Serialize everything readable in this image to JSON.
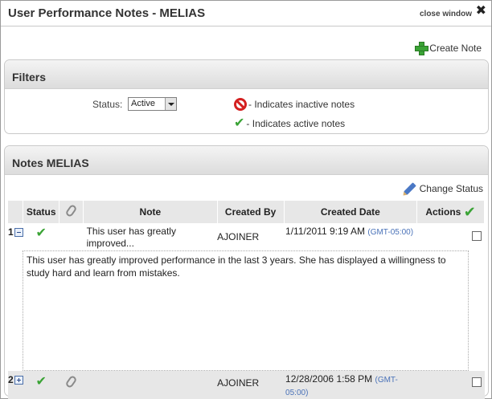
{
  "window": {
    "title": "User Performance Notes - MELIAS",
    "close_label": "close window",
    "close_glyph": "✖"
  },
  "toolbar": {
    "create_note_label": "Create Note"
  },
  "filters": {
    "heading": "Filters",
    "status_label": "Status:",
    "status_value": "Active",
    "legend_inactive": "- Indicates inactive notes",
    "legend_active": "- Indicates active notes"
  },
  "notes": {
    "heading": "Notes MELIAS",
    "change_status_label": "Change Status",
    "columns": {
      "status": "Status",
      "note": "Note",
      "created_by": "Created By",
      "created_date": "Created Date",
      "actions": "Actions"
    },
    "rows": [
      {
        "num": "1",
        "note": "This user has greatly improved...",
        "created_by": "AJOINER",
        "created_date": "1/11/2011 9:19 AM",
        "timezone": "GMT-05:00",
        "detail": "This user has greatly improved performance in the last 3 years. She has displayed a willingness to study hard and learn from mistakes."
      },
      {
        "num": "2",
        "note": "",
        "created_by": "AJOINER",
        "created_date": "12/28/2006 1:58 PM",
        "timezone": "GMT-05:00"
      }
    ]
  },
  "colors": {
    "accent_green": "#3aa335",
    "inactive_red": "#d42020",
    "link_blue": "#4a72b8"
  }
}
